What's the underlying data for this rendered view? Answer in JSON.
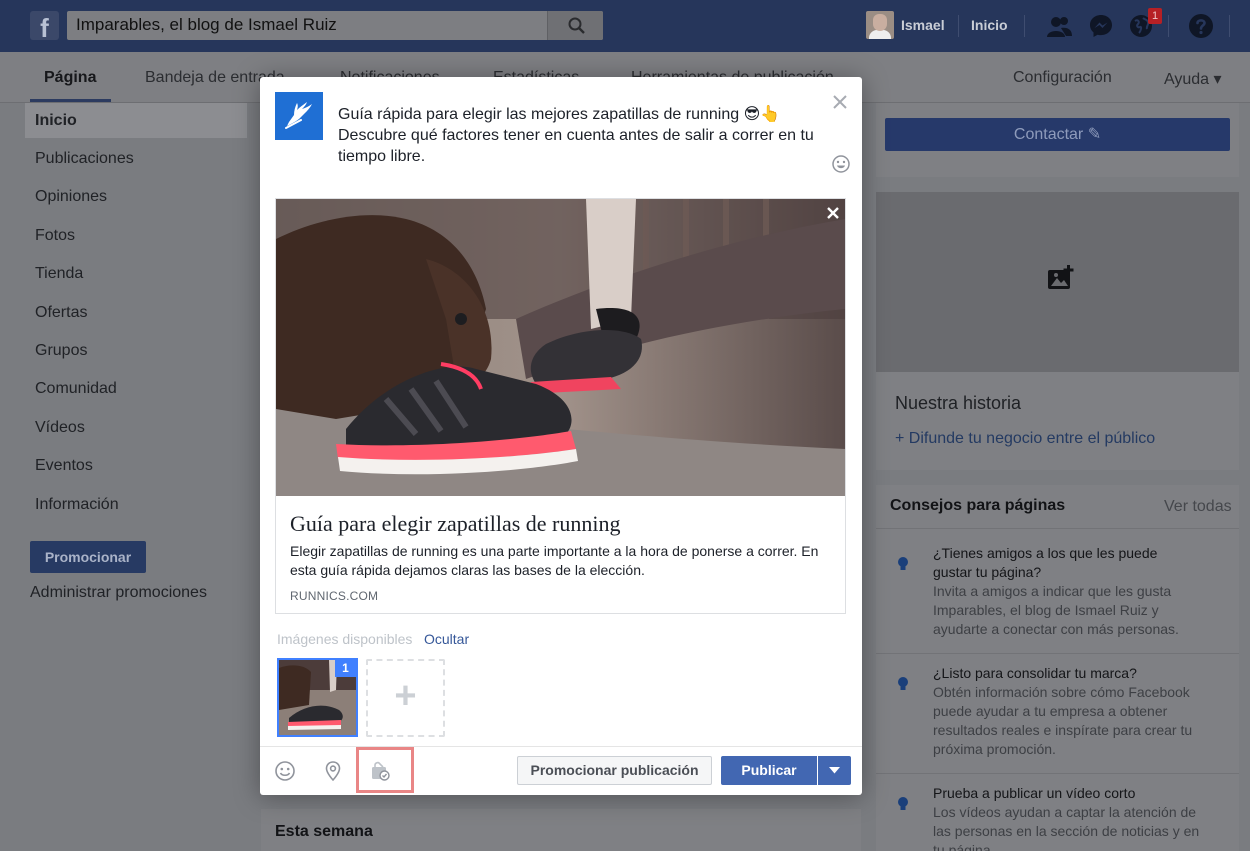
{
  "topbar": {
    "logo_letter": "f",
    "search_value": "Imparables, el blog de Ismael Ruiz",
    "user_name": "Ismael",
    "home_label": "Inicio",
    "notification_count": "1",
    "icons": [
      "friends-icon",
      "messenger-icon",
      "globe-icon",
      "help-icon"
    ]
  },
  "pagenav": {
    "items": [
      "Página",
      "Bandeja de entrada",
      "Notificaciones",
      "Estadísticas",
      "Herramientas de publicación"
    ],
    "settings": "Configuración",
    "help": "Ayuda ▾"
  },
  "sidebar": {
    "items": [
      "Inicio",
      "Publicaciones",
      "Opiniones",
      "Fotos",
      "Tienda",
      "Ofertas",
      "Grupos",
      "Comunidad",
      "Vídeos",
      "Eventos",
      "Información"
    ],
    "promote_button": "Promocionar",
    "manage_promotions": "Administrar promociones"
  },
  "right": {
    "contact_button": "Contactar ✎",
    "story_title": "Nuestra historia",
    "story_link": "+ Difunde tu negocio entre el público",
    "tips_title": "Consejos para páginas",
    "tips_see_all": "Ver todas",
    "tips": [
      {
        "title": "¿Tienes amigos a los que les puede gustar tu página?",
        "body": "Invita a amigos a indicar que les gusta Imparables, el blog de Ismael Ruiz y ayudarte a conectar con más personas."
      },
      {
        "title": "¿Listo para consolidar tu marca?",
        "body": "Obtén información sobre cómo Facebook puede ayudar a tu empresa a obtener resultados reales e inspírate para crear tu próxima promoción."
      },
      {
        "title": "Prueba a publicar un vídeo corto",
        "body": "Los vídeos ayudan a captar la atención de las personas en la sección de noticias y en tu página."
      }
    ]
  },
  "week_title": "Esta semana",
  "composer": {
    "post_text": "Guía rápida para elegir las mejores zapatillas de running 😎👆 Descubre qué factores tener en cuenta antes de salir a correr en tu tiempo libre.",
    "card_title": "Guía para elegir zapatillas de running",
    "card_description": "Elegir zapatillas de running es una parte importante a la hora de ponerse a correr. En esta guía rápida dejamos claras las bases de la elección.",
    "card_domain": "RUNNICS.COM",
    "images_label": "Imágenes disponibles",
    "hide_link": "Ocultar",
    "thumb_index": "1",
    "add_symbol": "+",
    "promote_post_button": "Promocionar publicación",
    "publish_button": "Publicar"
  },
  "colors": {
    "facebook_blue": "#4267b2",
    "link_blue": "#365899",
    "highlight": "#e98686"
  }
}
